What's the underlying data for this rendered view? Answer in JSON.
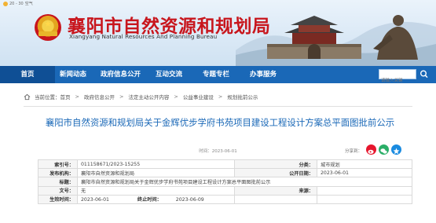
{
  "header": {
    "weather": "20 - 30",
    "weather_aqi": "空气",
    "site_title": "襄阳市自然资源和规划局",
    "site_subtitle": "Xiangyang Natural Resources And Planning Bureau"
  },
  "nav": {
    "items": [
      "首页",
      "新闻动态",
      "政府信息公开",
      "互动交流",
      "专题专栏",
      "办事服务"
    ],
    "search_placeholder": "请输入关键"
  },
  "breadcrumb": {
    "prefix": "当前位置：",
    "items": [
      "首页",
      "政府信息公开",
      "法定主动公开内容",
      "公益事业建设",
      "规划批前公示"
    ]
  },
  "article": {
    "title": "襄阳市自然资源和规划局关于金辉优步学府书苑项目建设工程设计方案总平面图批前公示",
    "pubtime": "时间：2023-06-01",
    "share_label": "分享到："
  },
  "info_table": {
    "index_label": "索引号：",
    "index_value": "011158671/2023-15255",
    "category_label": "分类：",
    "category_value": "城市规划",
    "publisher_label": "发布机构：",
    "publisher_value": "襄阳市自然资源和规划局",
    "pubdate_label": "公开日期：",
    "pubdate_value": "2023-06-01",
    "title_label": "标题：",
    "title_value": "襄阳市自然资源和规划局关于金辉优步学府书苑项目建设工程设计方案总平面图批前公示",
    "docno_label": "文号：",
    "docno_value": "无",
    "source_label": "来源：",
    "source_value": "",
    "effective_label": "生效时间：",
    "effective_value": "2023-06-01",
    "abolish_label": "终止时间：",
    "abolish_value": "2023-06-09"
  },
  "colors": {
    "brand_red": "#c8161d",
    "nav_blue": "#1a68b7",
    "title_blue": "#1a68b7"
  }
}
